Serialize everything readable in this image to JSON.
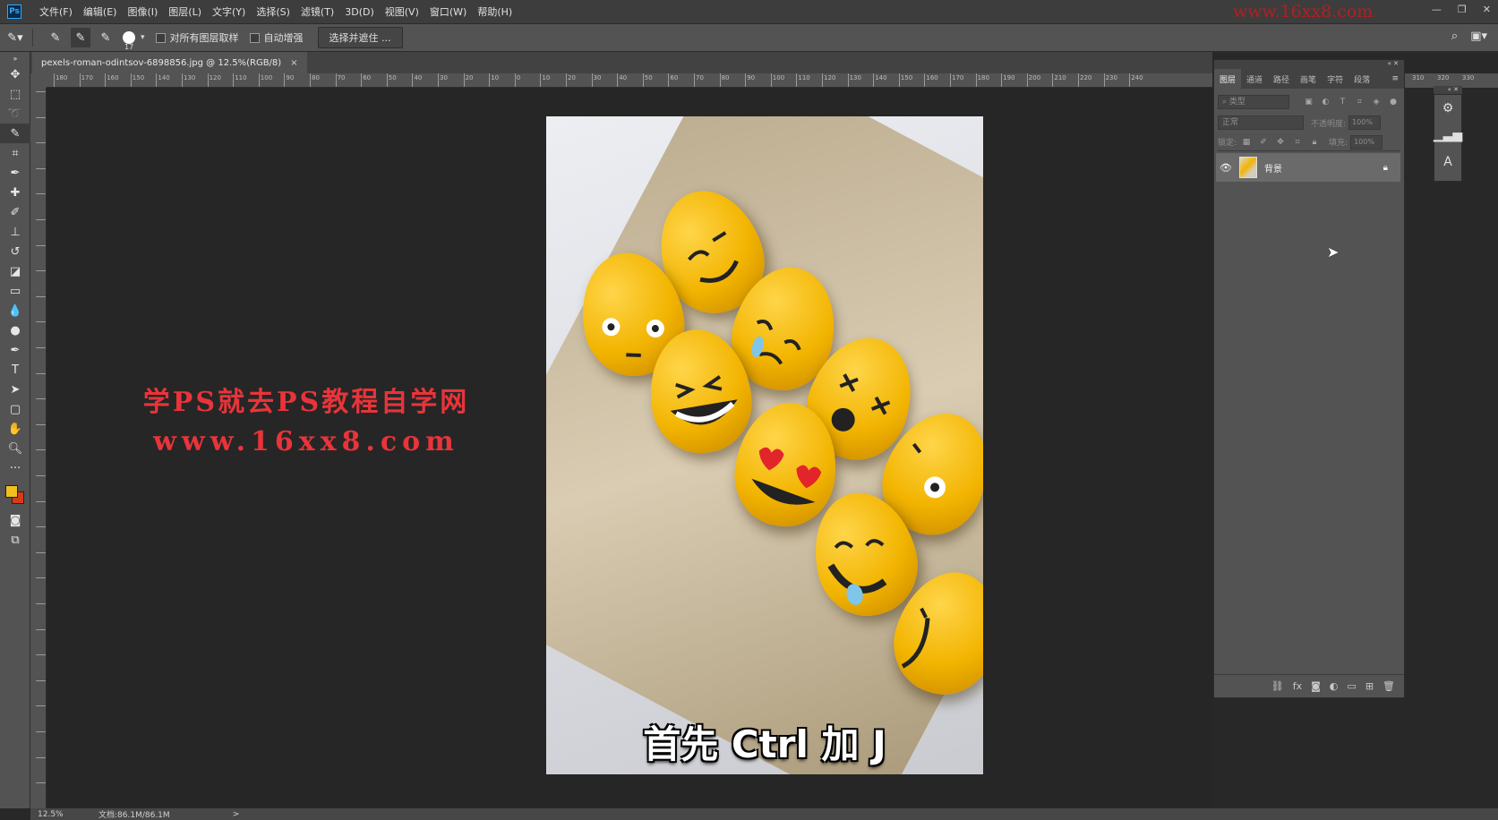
{
  "app": {
    "logo": "Ps"
  },
  "menu": [
    "文件(F)",
    "编辑(E)",
    "图像(I)",
    "图层(L)",
    "文字(Y)",
    "选择(S)",
    "滤镜(T)",
    "3D(D)",
    "视图(V)",
    "窗口(W)",
    "帮助(H)"
  ],
  "watermark_url": "www.16xx8.com",
  "options": {
    "brush_size": "17",
    "sample_all_label": "对所有图层取样",
    "auto_enhance_label": "自动增强",
    "select_mask_label": "选择并遮住 ..."
  },
  "document": {
    "tab_title": "pexels-roman-odintsov-6898856.jpg @ 12.5%(RGB/8)",
    "close": "×",
    "caption": "首先 Ctrl 加 J"
  },
  "overlay": {
    "line1": "学PS就去PS教程自学网",
    "line2": "www.16xx8.com"
  },
  "ruler_top_labels": [
    "180",
    "170",
    "160",
    "150",
    "140",
    "130",
    "120",
    "110",
    "100",
    "90",
    "80",
    "70",
    "60",
    "50",
    "40",
    "30",
    "20",
    "10",
    "0",
    "10",
    "20",
    "30",
    "40",
    "50",
    "60",
    "70",
    "80",
    "90",
    "100",
    "110",
    "120",
    "130",
    "140",
    "150",
    "160",
    "170",
    "180",
    "190",
    "200",
    "210",
    "220",
    "230",
    "240"
  ],
  "ruler_right_labels": [
    "310",
    "320",
    "330"
  ],
  "status": {
    "zoom": "12.5%",
    "doc_info": "文档:86.1M/86.1M",
    "arrow": ">"
  },
  "layers_panel": {
    "tabs": [
      "图层",
      "通道",
      "路径",
      "画笔",
      "字符",
      "段落"
    ],
    "filter_placeholder": "类型",
    "blend_mode": "正常",
    "opacity_label": "不透明度:",
    "opacity_value": "100%",
    "lock_label": "锁定:",
    "fill_label": "填充:",
    "fill_value": "100%",
    "layers": [
      {
        "name": "背景",
        "visible": true,
        "locked": true
      }
    ]
  },
  "colors": {
    "foreground": "#f0c020",
    "background": "#d63a1e",
    "watermark": "#e8343a"
  }
}
